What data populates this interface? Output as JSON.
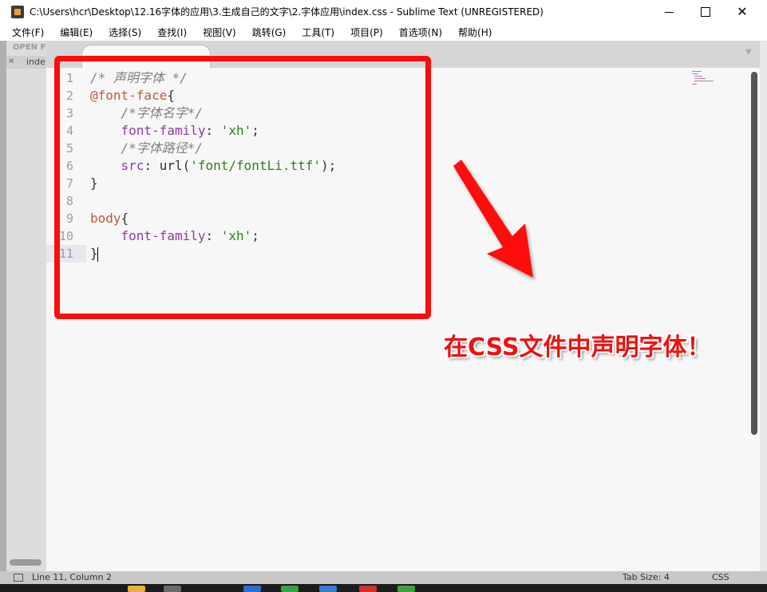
{
  "window": {
    "title": "C:\\Users\\hcr\\Desktop\\12.16字体的应用\\3.生成自己的文字\\2.字体应用\\index.css - Sublime Text (UNREGISTERED)"
  },
  "menu": {
    "items": [
      "文件(F)",
      "编辑(E)",
      "选择(S)",
      "查找(I)",
      "视图(V)",
      "跳转(G)",
      "工具(T)",
      "项目(P)",
      "首选项(N)",
      "帮助(H)"
    ]
  },
  "sidebar": {
    "header": "OPEN FI",
    "file_close": "×",
    "file_name": "inde"
  },
  "tabbar": {
    "dropdown": "▼"
  },
  "editor": {
    "line_numbers": [
      "1",
      "2",
      "3",
      "4",
      "5",
      "6",
      "7",
      "8",
      "9",
      "10",
      "11"
    ],
    "lines": [
      [
        {
          "t": "/* 声明字体 */",
          "c": "comment"
        }
      ],
      [
        {
          "t": "@font-face",
          "c": "atrule"
        },
        {
          "t": "{",
          "c": "punc"
        }
      ],
      [
        {
          "t": "    ",
          "c": "punc"
        },
        {
          "t": "/*字体名字*/",
          "c": "comment"
        }
      ],
      [
        {
          "t": "    ",
          "c": "punc"
        },
        {
          "t": "font-family",
          "c": "prop"
        },
        {
          "t": ": ",
          "c": "punc"
        },
        {
          "t": "'xh'",
          "c": "str"
        },
        {
          "t": ";",
          "c": "punc"
        }
      ],
      [
        {
          "t": "    ",
          "c": "punc"
        },
        {
          "t": "/*字体路径*/",
          "c": "comment"
        }
      ],
      [
        {
          "t": "    ",
          "c": "punc"
        },
        {
          "t": "src",
          "c": "prop"
        },
        {
          "t": ": ",
          "c": "punc"
        },
        {
          "t": "url(",
          "c": "punc"
        },
        {
          "t": "'font/fontLi.ttf'",
          "c": "str"
        },
        {
          "t": ");",
          "c": "punc"
        }
      ],
      [
        {
          "t": "}",
          "c": "punc"
        }
      ],
      [
        {
          "t": "",
          "c": "punc"
        }
      ],
      [
        {
          "t": "body",
          "c": "sel"
        },
        {
          "t": "{",
          "c": "punc"
        }
      ],
      [
        {
          "t": "    ",
          "c": "punc"
        },
        {
          "t": "font-family",
          "c": "prop"
        },
        {
          "t": ": ",
          "c": "punc"
        },
        {
          "t": "'xh'",
          "c": "str"
        },
        {
          "t": ";",
          "c": "punc"
        }
      ],
      [
        {
          "t": "}",
          "c": "punc"
        }
      ]
    ],
    "current_line": 11
  },
  "statusbar": {
    "position": "Line 11, Column 2",
    "tab_size": "Tab Size: 4",
    "syntax": "CSS"
  },
  "annotation": {
    "text": "在CSS文件中声明字体！",
    "color": "#f01010"
  },
  "colors": {
    "highlight_red": "#ff0b0b",
    "comment": "#7f7f7f",
    "property": "#8e3aa8",
    "string": "#2f7d1e",
    "at_rule": "#c0573a"
  }
}
